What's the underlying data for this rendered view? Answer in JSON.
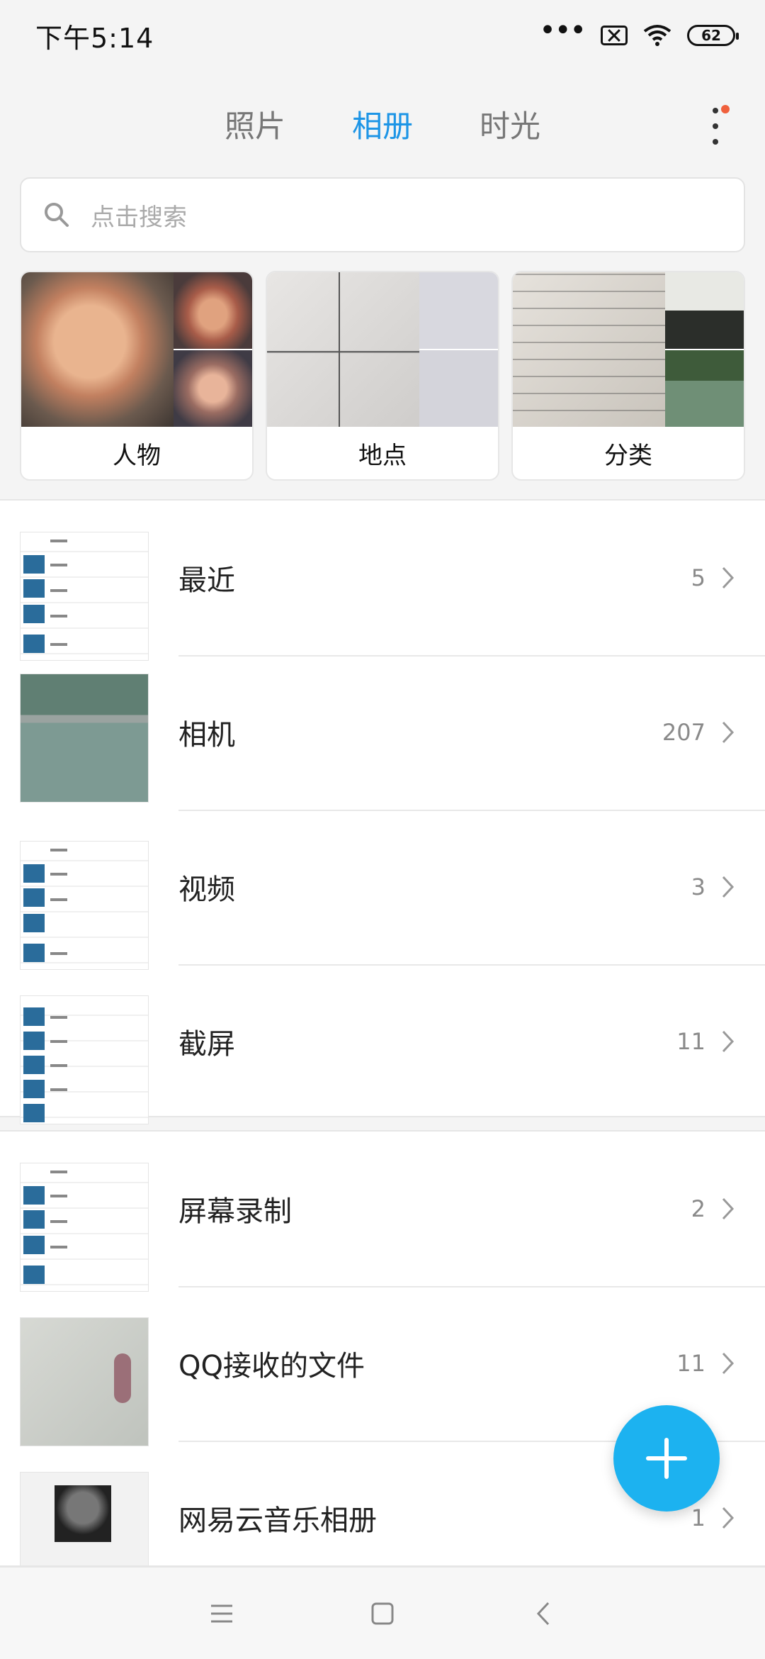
{
  "status_bar": {
    "time": "下午5:14",
    "battery": "62"
  },
  "tabs": [
    {
      "label": "照片",
      "active": false
    },
    {
      "label": "相册",
      "active": true
    },
    {
      "label": "时光",
      "active": false
    }
  ],
  "search": {
    "placeholder": "点击搜索"
  },
  "categories": [
    {
      "label": "人物"
    },
    {
      "label": "地点"
    },
    {
      "label": "分类"
    }
  ],
  "albums_primary": [
    {
      "name": "最近",
      "count": "5"
    },
    {
      "name": "相机",
      "count": "207"
    },
    {
      "name": "视频",
      "count": "3"
    },
    {
      "name": "截屏",
      "count": "11"
    }
  ],
  "albums_secondary": [
    {
      "name": "屏幕录制",
      "count": "2"
    },
    {
      "name": "QQ接收的文件",
      "count": "11"
    },
    {
      "name": "网易云音乐相册",
      "count": "1"
    }
  ],
  "colors": {
    "accent": "#1d95e6",
    "fab": "#1cb2f0",
    "notification_dot": "#f0603c"
  }
}
